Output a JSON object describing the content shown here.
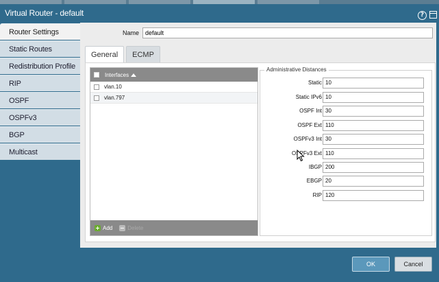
{
  "window": {
    "title": "Virtual Router - default"
  },
  "sidebar": {
    "items": [
      {
        "label": "Router Settings",
        "active": true
      },
      {
        "label": "Static Routes"
      },
      {
        "label": "Redistribution Profile"
      },
      {
        "label": "RIP"
      },
      {
        "label": "OSPF"
      },
      {
        "label": "OSPFv3"
      },
      {
        "label": "BGP"
      },
      {
        "label": "Multicast"
      }
    ]
  },
  "name_field": {
    "label": "Name",
    "value": "default"
  },
  "tabs": [
    {
      "label": "General",
      "active": true
    },
    {
      "label": "ECMP"
    }
  ],
  "interfaces": {
    "header": "Interfaces",
    "rows": [
      "vlan.10",
      "vlan.797"
    ],
    "add_label": "Add",
    "delete_label": "Delete"
  },
  "admin": {
    "legend": "Administrative Distances",
    "fields": [
      {
        "label": "Static",
        "value": "10"
      },
      {
        "label": "Static IPv6",
        "value": "10"
      },
      {
        "label": "OSPF Int",
        "value": "30"
      },
      {
        "label": "OSPF Ext",
        "value": "110"
      },
      {
        "label": "OSPFv3 Int",
        "value": "30"
      },
      {
        "label": "OSPFv3 Ext",
        "value": "110"
      },
      {
        "label": "IBGP",
        "value": "200"
      },
      {
        "label": "EBGP",
        "value": "20"
      },
      {
        "label": "RIP",
        "value": "120"
      }
    ]
  },
  "footer": {
    "ok_label": "OK",
    "cancel_label": "Cancel"
  },
  "colors": {
    "title_bar": "#2f6a8c",
    "ok_button": "#5b98bb",
    "add_icon": "#6aab2e"
  }
}
